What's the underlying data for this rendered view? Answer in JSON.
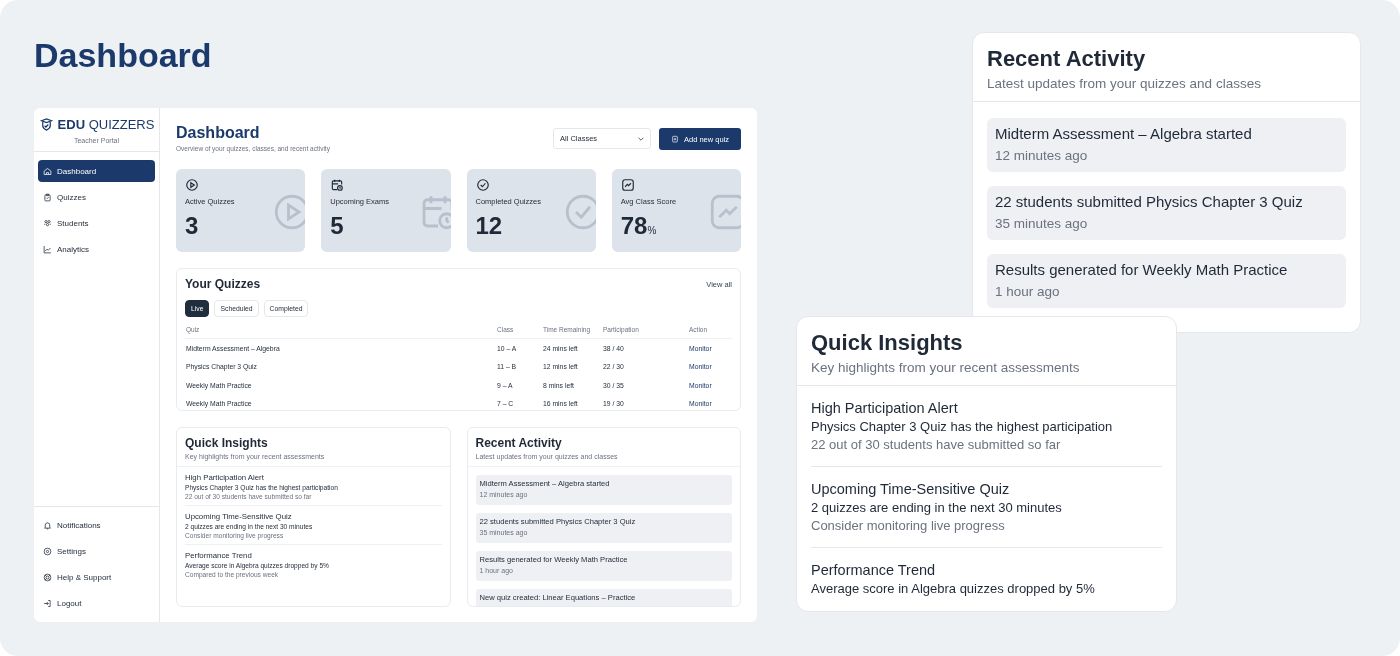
{
  "page_title": "Dashboard",
  "app": {
    "brand": {
      "bold": "EDU",
      "light": "QUIZZERS",
      "subtitle": "Teacher Portal"
    },
    "nav": [
      {
        "label": "Dashboard",
        "selected": true
      },
      {
        "label": "Quizzes",
        "selected": false
      },
      {
        "label": "Students",
        "selected": false
      },
      {
        "label": "Analytics",
        "selected": false
      }
    ],
    "footer_nav": [
      "Notifications",
      "Settings",
      "Help & Support",
      "Logout"
    ],
    "header": {
      "title": "Dashboard",
      "subtitle": "Overview of your quizzes, classes, and recent activity",
      "class_filter": "All Classes",
      "add_button": "Add new quiz"
    },
    "stats": [
      {
        "label": "Active Quizzes",
        "value": "3"
      },
      {
        "label": "Upcoming Exams",
        "value": "5"
      },
      {
        "label": "Completed Quizzes",
        "value": "12"
      },
      {
        "label": "Avg Class Score",
        "value": "78",
        "unit": "%"
      }
    ],
    "quizzes": {
      "title": "Your Quizzes",
      "view_all": "View all",
      "tabs": [
        {
          "label": "Live",
          "selected": true
        },
        {
          "label": "Scheduled",
          "selected": false
        },
        {
          "label": "Completed",
          "selected": false
        }
      ],
      "columns": [
        "Quiz",
        "Class",
        "Time Remaining",
        "Participation",
        "Action"
      ],
      "rows": [
        [
          "Midterm Assessment – Algebra",
          "10 – A",
          "24 mins left",
          "38 / 40",
          "Monitor"
        ],
        [
          "Physics Chapter 3 Quiz",
          "11 – B",
          "12 mins left",
          "22 / 30",
          "Monitor"
        ],
        [
          "Weekly Math Practice",
          "9 – A",
          "8 mins left",
          "30 / 35",
          "Monitor"
        ],
        [
          "Weekly Math Practice",
          "7 – C",
          "16 mins left",
          "19 / 30",
          "Monitor"
        ]
      ]
    },
    "insights": {
      "title": "Quick Insights",
      "subtitle": "Key highlights from your recent assessments",
      "items": [
        {
          "title": "High Participation Alert",
          "detail": "Physics Chapter 3 Quiz has the highest participation",
          "note": "22 out of 30 students have submitted so far"
        },
        {
          "title": "Upcoming Time-Sensitive Quiz",
          "detail": "2 quizzes are ending in the next 30 minutes",
          "note": "Consider monitoring live progress"
        },
        {
          "title": "Performance Trend",
          "detail": "Average score in Algebra quizzes dropped by 5%",
          "note": "Compared to the previous week"
        }
      ]
    },
    "activity": {
      "title": "Recent Activity",
      "subtitle": "Latest updates from your quizzes and classes",
      "items": [
        {
          "text": "Midterm Assessment – Algebra started",
          "time": "12 minutes ago"
        },
        {
          "text": "22 students submitted Physics Chapter 3 Quiz",
          "time": "35 minutes ago"
        },
        {
          "text": "Results generated for Weekly Math Practice",
          "time": "1 hour ago"
        },
        {
          "text": "New quiz created: Linear Equations – Practice"
        }
      ]
    }
  },
  "activity_card": {
    "title": "Recent Activity",
    "subtitle": "Latest updates from your quizzes and classes",
    "items": [
      {
        "text": "Midterm Assessment – Algebra started",
        "time": "12 minutes ago"
      },
      {
        "text": "22 students submitted Physics Chapter 3 Quiz",
        "time": "35 minutes ago"
      },
      {
        "text": "Results generated for Weekly Math Practice",
        "time": "1 hour ago"
      }
    ]
  },
  "insights_card": {
    "title": "Quick Insights",
    "subtitle": "Key highlights from your recent assessments",
    "items": [
      {
        "title": "High Participation Alert",
        "detail": "Physics Chapter 3 Quiz has the highest participation",
        "note": "22 out of 30 students have submitted so far"
      },
      {
        "title": "Upcoming Time-Sensitive Quiz",
        "detail": "2 quizzes are ending in the next 30 minutes",
        "note": "Consider monitoring live progress"
      },
      {
        "title": "Performance Trend",
        "detail": "Average score in Algebra quizzes dropped by 5%"
      }
    ]
  }
}
